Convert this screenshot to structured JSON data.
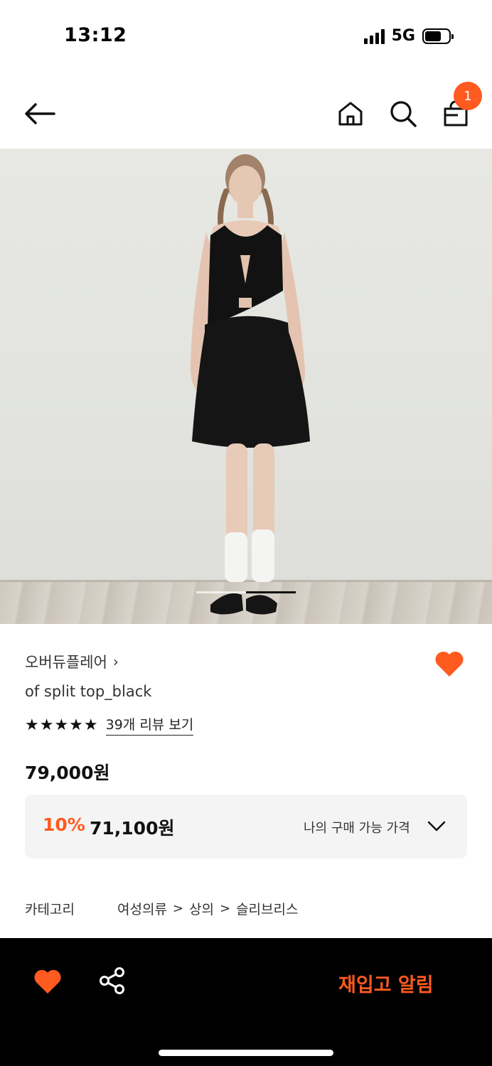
{
  "status_bar": {
    "time": "13:12",
    "network": "5G",
    "battery_level": 0.7
  },
  "nav": {
    "back_icon": "arrow-left-icon",
    "home_icon": "home-icon",
    "search_icon": "search-icon",
    "cart_icon": "shopping-bag-icon",
    "cart_count": "1"
  },
  "gallery": {
    "image": "model wearing black sleeveless split top and black skirt",
    "current_index": 2,
    "total": 2
  },
  "product": {
    "brand": "오버듀플레어",
    "brand_chevron": "›",
    "name": "of split top_black",
    "stars": "★★★★★",
    "review_link": "39개 리뷰 보기",
    "price": "79,000원",
    "discount_rate": "10%",
    "discount_price": "71,100원",
    "discount_label": "나의 구매 가능 가격",
    "category_label": "카테고리",
    "category_path": [
      "여성의류",
      "상의",
      "슬리브리스"
    ],
    "category_separator": ">"
  },
  "bottom_bar": {
    "wish_icon": "heart-icon",
    "share_icon": "share-icon",
    "restock_label": "재입고 알림"
  },
  "colors": {
    "accent": "#ff5a1f",
    "bottom_bar_bg": "#000000",
    "discount_box_bg": "#f4f4f4"
  }
}
